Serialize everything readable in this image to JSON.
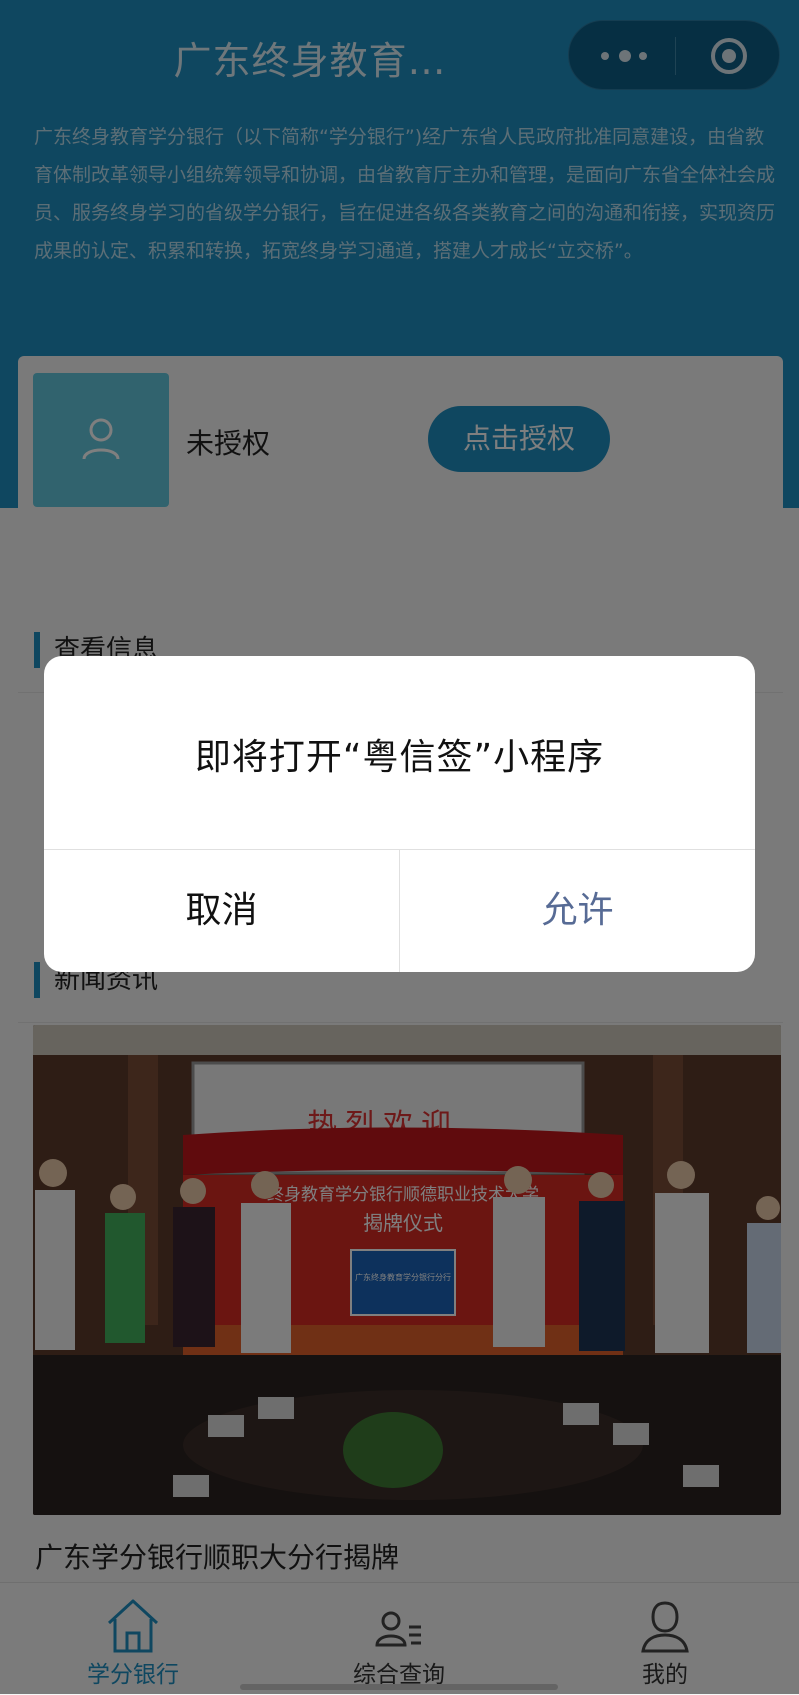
{
  "header": {
    "title": "广东终身教育…",
    "menu_icon": "more-dots-icon",
    "close_icon": "target-circle-icon",
    "intro": "广东终身教育学分银行（以下简称“学分银行”)经广东省人民政府批准同意建设，由省教育体制改革领导小组统筹领导和协调，由省教育厅主办和管理，是面向广东省全体社会成员、服务终身学习的省级学分银行，旨在促进各级各类教育之间的沟通和衔接，实现资历成果的认定、积累和转换，拓宽终身学习通道，搭建人才成长“立交桥”。"
  },
  "auth": {
    "status": "未授权",
    "button": "点击授权"
  },
  "sections": {
    "info": "查看信息",
    "news": "新闻资讯"
  },
  "news": {
    "caption": "广东学分银行顺职大分行揭牌",
    "image": {
      "banner_top": "热烈欢迎",
      "banner_middle": "终身教育学分银行顺德职业技术大学",
      "banner_ceremony": "揭牌仪式",
      "plaque": "广东终身教育学分银行分行"
    }
  },
  "tabbar": {
    "items": [
      {
        "label": "学分银行",
        "icon": "home-icon",
        "active": true
      },
      {
        "label": "综合查询",
        "icon": "person-list-icon",
        "active": false
      },
      {
        "label": "我的",
        "icon": "person-icon",
        "active": false
      }
    ]
  },
  "dialog": {
    "message": "即将打开“粤信签”小程序",
    "cancel": "取消",
    "allow": "允许"
  },
  "colors": {
    "primary": "#1f8fc1",
    "avatar_bg": "#63c6dc",
    "allow_text": "#576b95"
  }
}
